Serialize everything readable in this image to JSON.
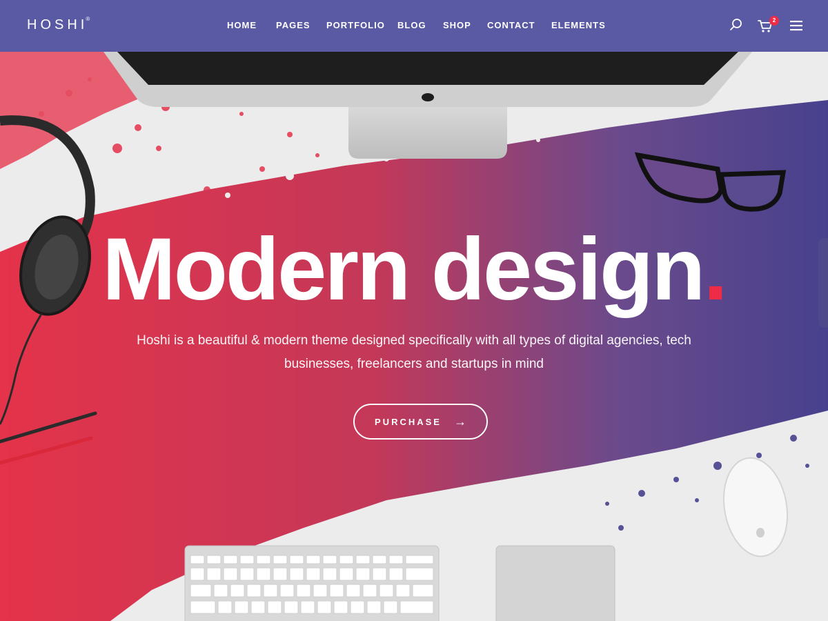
{
  "brand": {
    "name": "HOSHI",
    "mark": "®"
  },
  "nav": {
    "items": [
      {
        "id": "home",
        "label": "HOME"
      },
      {
        "id": "pages",
        "label": "PAGES"
      },
      {
        "id": "portfolio",
        "label": "PORTFOLIO"
      },
      {
        "id": "blog",
        "label": "BLOG"
      },
      {
        "id": "shop",
        "label": "SHOP"
      },
      {
        "id": "contact",
        "label": "CONTACT"
      },
      {
        "id": "elements",
        "label": "ELEMENTS"
      }
    ]
  },
  "header_icons": {
    "search": "search-icon",
    "cart": "cart-icon",
    "menu": "hamburger-menu-icon",
    "cart_count": "2"
  },
  "hero": {
    "title": "Modern design",
    "title_dot": ".",
    "subtitle": "Hoshi is a beautiful & modern theme designed specifically with all types of digital agencies, tech businesses, freelancers and startups in mind",
    "button_label": "PURCHASE",
    "button_arrow": "→"
  },
  "colors": {
    "header_bg": "#5a5aa4",
    "accent_red": "#ee2c47",
    "gradient_start": "#e4334a",
    "gradient_end": "#47418d",
    "desk": "#ececec"
  }
}
